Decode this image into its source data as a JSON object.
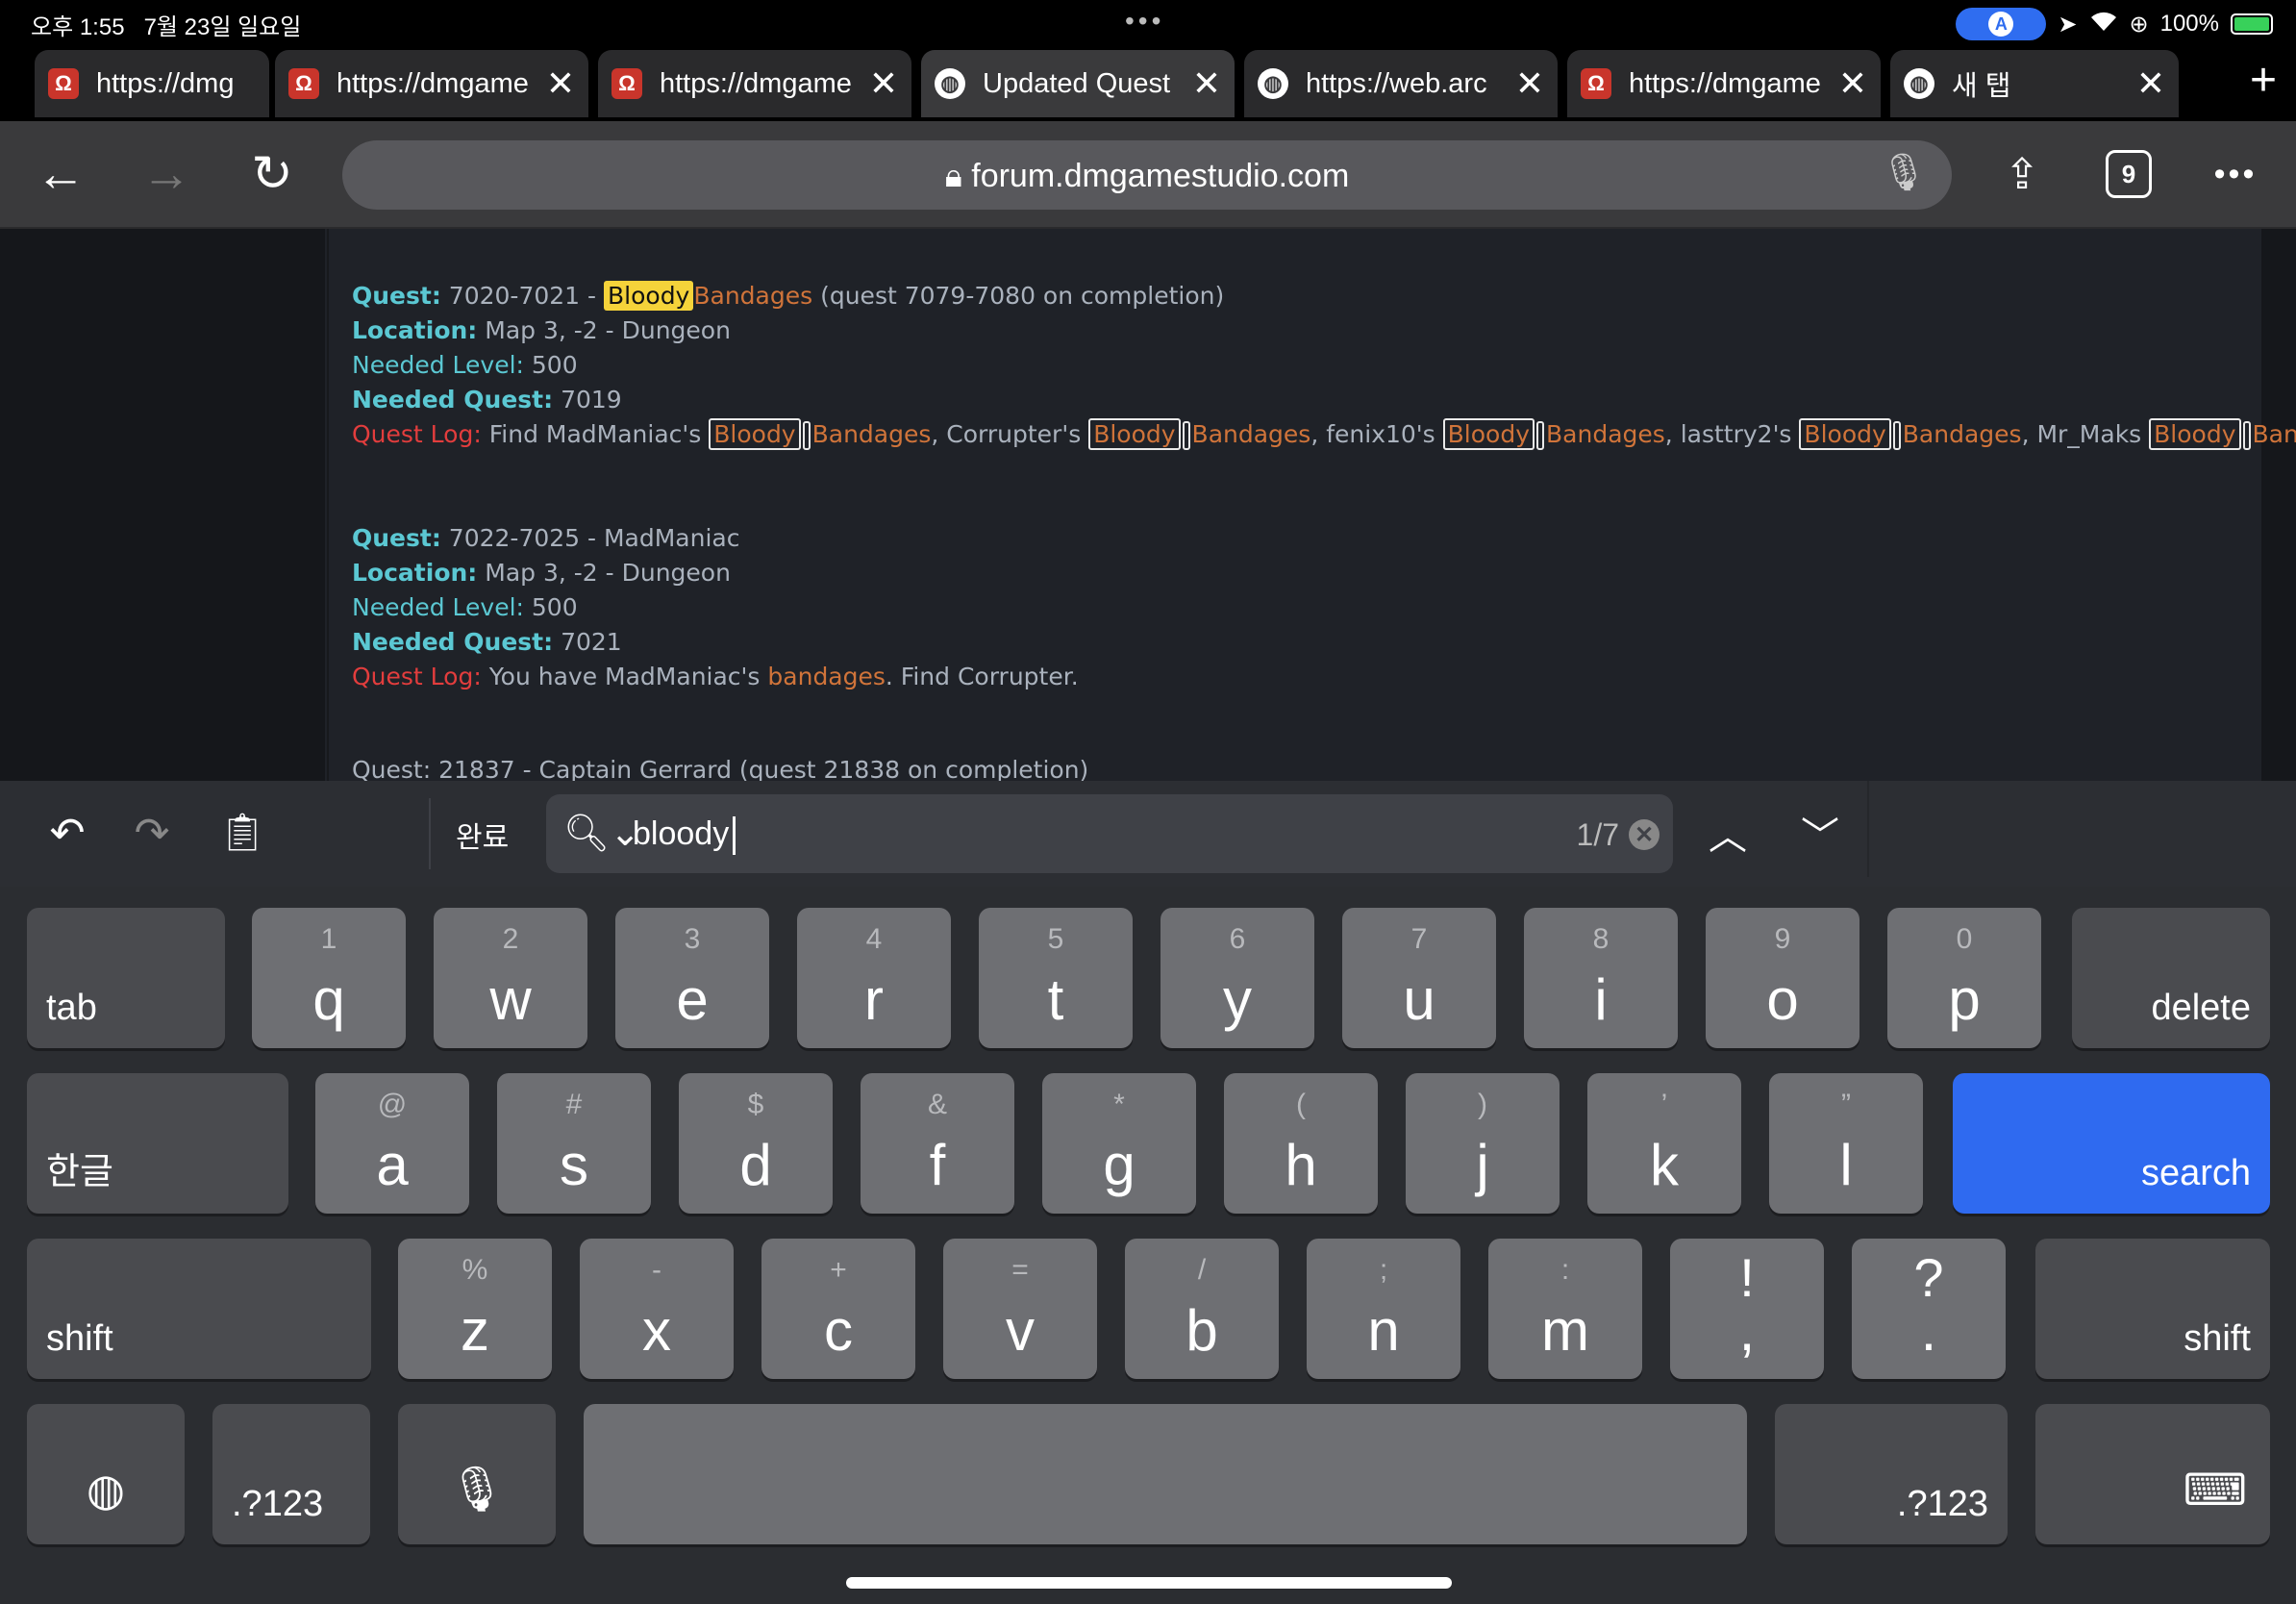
{
  "status": {
    "time": "오후 1:55",
    "date": "7월 23일 일요일",
    "battery": "100%"
  },
  "tabs": [
    {
      "title": "https://dmg",
      "icon": "omega-icon"
    },
    {
      "title": "https://dmgame",
      "icon": "omega-icon"
    },
    {
      "title": "https://dmgame",
      "icon": "omega-icon"
    },
    {
      "title": "Updated Quest",
      "icon": "globe-icon",
      "active": true
    },
    {
      "title": "https://web.arc",
      "icon": "globe-icon"
    },
    {
      "title": "https://dmgame",
      "icon": "omega-icon"
    },
    {
      "title": "새 탭",
      "icon": "globe-icon"
    }
  ],
  "toolbar": {
    "url": "forum.dmgamestudio.com",
    "tab_count": "9"
  },
  "content": {
    "quest1": {
      "quest_label": "Quest:",
      "quest_id": "7020-7021",
      "quest_title_a": "Bloody",
      "quest_title_b": "Bandages",
      "quest_note": "(quest 7079-7080 on completion)",
      "location_label": "Location:",
      "location": "Map 3, -2 - Dungeon",
      "level_label": "Needed Level:",
      "level": "500",
      "needquest_label": "Needed Quest:",
      "needquest": "7019",
      "log_label": "Quest Log:",
      "log_prefix": "Find MadManiac's",
      "w_bloody": "Bloody",
      "w_bandages": "Bandages",
      "sep1": ", Corrupter's",
      "sep2": ", fenix10's",
      "sep3": ", lasttry2's",
      "sep4": ", Mr_Maks",
      "end": "."
    },
    "quest2": {
      "quest_label": "Quest:",
      "quest_id": "7022-7025 - MadManiac",
      "location_label": "Location:",
      "location": "Map 3, -2 - Dungeon",
      "level_label": "Needed Level:",
      "level": "500",
      "needquest_label": "Needed Quest:",
      "needquest": "7021",
      "log_label": "Quest Log:",
      "log_prefix": "You have MadManiac's",
      "log_word": "bandages",
      "log_suffix": ". Find Corrupter."
    },
    "cutoff_line": "Quest: 21837 - Captain Gerrard (quest 21838 on completion)"
  },
  "findbar": {
    "done_label": "완료",
    "query": "bloody",
    "count": "1/7"
  },
  "keyboard": {
    "row1": [
      {
        "main": "q",
        "alt": "1"
      },
      {
        "main": "w",
        "alt": "2"
      },
      {
        "main": "e",
        "alt": "3"
      },
      {
        "main": "r",
        "alt": "4"
      },
      {
        "main": "t",
        "alt": "5"
      },
      {
        "main": "y",
        "alt": "6"
      },
      {
        "main": "u",
        "alt": "7"
      },
      {
        "main": "i",
        "alt": "8"
      },
      {
        "main": "o",
        "alt": "9"
      },
      {
        "main": "p",
        "alt": "0"
      }
    ],
    "row2": [
      {
        "main": "a",
        "alt": "@"
      },
      {
        "main": "s",
        "alt": "#"
      },
      {
        "main": "d",
        "alt": "$"
      },
      {
        "main": "f",
        "alt": "&"
      },
      {
        "main": "g",
        "alt": "*"
      },
      {
        "main": "h",
        "alt": "("
      },
      {
        "main": "j",
        "alt": ")"
      },
      {
        "main": "k",
        "alt": "’"
      },
      {
        "main": "l",
        "alt": "”"
      }
    ],
    "row3": [
      {
        "main": "z",
        "alt": "%"
      },
      {
        "main": "x",
        "alt": "-"
      },
      {
        "main": "c",
        "alt": "+"
      },
      {
        "main": "v",
        "alt": "="
      },
      {
        "main": "b",
        "alt": "/"
      },
      {
        "main": "n",
        "alt": ";"
      },
      {
        "main": "m",
        "alt": ":"
      },
      {
        "main": ",",
        "alt": "!"
      },
      {
        "main": ".",
        "alt": "?"
      }
    ],
    "tab": "tab",
    "delete": "delete",
    "hangul": "한글",
    "search": "search",
    "shift": "shift",
    "numbers": ".?123"
  }
}
